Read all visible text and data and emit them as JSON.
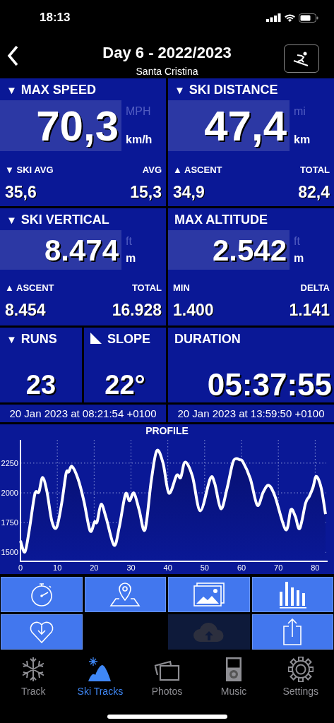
{
  "status_bar": {
    "time": "18:13"
  },
  "header": {
    "title": "Day 6 - 2022/2023",
    "subtitle": "Santa Cristina"
  },
  "panels": [
    {
      "marker": "▼",
      "title": "MAX SPEED",
      "value": "70,3",
      "units": [
        {
          "label": "MPH",
          "selected": false
        },
        {
          "label": "km/h",
          "selected": true
        }
      ],
      "stats": [
        {
          "marker": "▼",
          "label": "SKI AVG",
          "value": "35,6"
        },
        {
          "label": "AVG",
          "value": "15,3"
        }
      ]
    },
    {
      "marker": "▼",
      "title": "SKI DISTANCE",
      "value": "47,4",
      "units": [
        {
          "label": "mi",
          "selected": false
        },
        {
          "label": "km",
          "selected": true
        }
      ],
      "stats": [
        {
          "marker": "▲",
          "label": "ASCENT",
          "value": "34,9"
        },
        {
          "label": "TOTAL",
          "value": "82,4"
        }
      ]
    },
    {
      "marker": "▼",
      "title": "SKI VERTICAL",
      "value": "8.474",
      "units": [
        {
          "label": "ft",
          "selected": false
        },
        {
          "label": "m",
          "selected": true
        }
      ],
      "stats": [
        {
          "marker": "▲",
          "label": "ASCENT",
          "value": "8.454"
        },
        {
          "label": "TOTAL",
          "value": "16.928"
        }
      ]
    },
    {
      "title": "MAX ALTITUDE",
      "value": "2.542",
      "units": [
        {
          "label": "ft",
          "selected": false
        },
        {
          "label": "m",
          "selected": true
        }
      ],
      "stats": [
        {
          "label": "MIN",
          "value": "1.400"
        },
        {
          "label": "DELTA",
          "value": "1.141"
        }
      ]
    }
  ],
  "counters": [
    {
      "kind": "dropdown",
      "marker": "▼",
      "title": "RUNS",
      "value": "23"
    },
    {
      "kind": "slope",
      "title": "SLOPE",
      "value": "22°"
    },
    {
      "kind": "plain",
      "title": "DURATION",
      "value": "05:37:55"
    }
  ],
  "times": [
    "20 Jan 2023 at 08:21:54 +0100",
    "20 Jan 2023 at 13:59:50 +0100"
  ],
  "profile": {
    "chart_data": {
      "type": "area",
      "title": "PROFILE",
      "grid": true,
      "xlim": [
        0,
        83
      ],
      "ylim": [
        1425,
        2445
      ],
      "xticks": [
        0,
        10,
        20,
        30,
        40,
        50,
        60,
        70,
        80
      ],
      "yticks": [
        1500,
        1750,
        2000,
        2250
      ],
      "x": [
        0,
        1.2,
        2.4,
        3.9,
        5,
        6,
        7.2,
        8.5,
        9.8,
        11.2,
        12.4,
        13.1,
        14,
        15.6,
        17.2,
        18.9,
        20.1,
        20.8,
        21.9,
        23.3,
        25.4,
        26.8,
        28.5,
        29.6,
        30.8,
        32.2,
        33.8,
        35.5,
        37,
        38.7,
        40.3,
        42.4,
        43.5,
        44.7,
        46.7,
        48.8,
        51.5,
        52.7,
        54.4,
        56,
        57.6,
        58.5,
        59.5,
        60.4,
        62.4,
        64.3,
        65.9,
        67.4,
        69.1,
        72,
        73.4,
        74.6,
        75.8,
        77.4,
        78.4,
        79.4,
        80.3,
        81.6,
        82.8
      ],
      "series": [
        {
          "color": "#ffffff",
          "values": [
            1597,
            1504,
            1690,
            1989,
            2007,
            2129,
            2007,
            1765,
            1709,
            1914,
            2166,
            2175,
            2222,
            2119,
            1933,
            1681,
            1756,
            1756,
            1905,
            1784,
            1560,
            1709,
            1989,
            1933,
            1998,
            1858,
            1690,
            2101,
            2353,
            2250,
            1998,
            2147,
            2129,
            2259,
            2138,
            1849,
            2119,
            2082,
            1867,
            2026,
            2250,
            2287,
            2278,
            2259,
            2119,
            1896,
            2007,
            2063,
            1970,
            1690,
            1858,
            1802,
            1700,
            1914,
            1970,
            2045,
            2138,
            2045,
            1821
          ]
        }
      ]
    }
  },
  "action_rows": [
    [
      {
        "disabled": false
      },
      {
        "disabled": false
      },
      {
        "disabled": false
      },
      {
        "disabled": false
      }
    ],
    [
      {
        "disabled": false
      },
      {
        "disabled": true
      },
      {
        "disabled": false
      }
    ]
  ],
  "tabs": [
    {
      "label": "Track",
      "selected": false
    },
    {
      "label": "Ski Tracks",
      "selected": true
    },
    {
      "label": "Photos",
      "selected": false
    },
    {
      "label": "Music",
      "selected": false
    },
    {
      "label": "Settings",
      "selected": false
    }
  ]
}
